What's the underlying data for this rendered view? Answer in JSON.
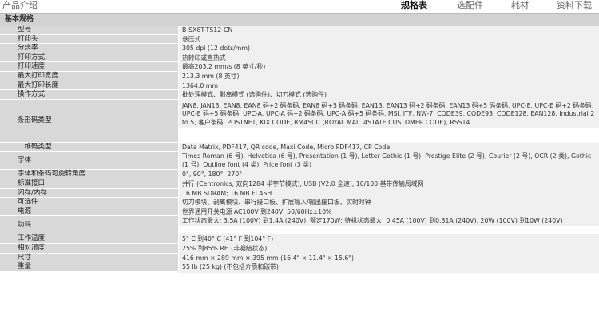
{
  "header": {
    "title": "产品介绍",
    "tabs": [
      {
        "label": "规格表",
        "active": true
      },
      {
        "label": "选配件",
        "active": false
      },
      {
        "label": "耗材",
        "active": false
      },
      {
        "label": "资料下载",
        "active": false
      }
    ]
  },
  "section": {
    "title": "基本规格"
  },
  "specs": [
    {
      "key": "型号",
      "value": "B-SX8T-TS12-CN"
    },
    {
      "key": "打印头",
      "value": "悬压式"
    },
    {
      "key": "分辨率",
      "value": "305 dpi (12 dots/mm)"
    },
    {
      "key": "打印方式",
      "value": "热转印或直热式"
    },
    {
      "key": "打印速度",
      "value": "最高203.2 mm/s (8 英寸/秒)"
    },
    {
      "key": "最大打印宽度",
      "value": "213.3 mm (8 英寸)"
    },
    {
      "key": "最大打印长度",
      "value": "1364.0 mm"
    },
    {
      "key": "操作方式",
      "value": "批处理模式、剥离模式 (选购件)、切刀模式 (选购件)"
    },
    {
      "key": "条形码类型",
      "value": "JAN8, JAN13, EAN8, EAN8 码+2 码条码, EAN8 码+5 码条码, EAN13, EAN13 码+2 码条码, EAN13 码+5 码条码, UPC-E, UPC-E 码+2 码条码, UPC-E 码+5 码条码, UPC-A, UPC-A 码+2 码条码, UPC-A 码+5 码条码, MSI, ITF, NW-7, CODE39, CODE93, CODE128, EAN128, Industrial 2 to 5, 客户条码, POSTNET, KIX CODE, RM4SCC (ROYAL MAIL 4STATE CUSTOMER CODE), RSS14"
    },
    {
      "key": "二维码类型",
      "value": "Data Matrix, PDF417, QR code, Maxi Code, Micro PDF417, CP Code"
    },
    {
      "key": "字体",
      "value": "Times Roman (6 号), Helvetica (6 号), Presentation (1 号), Letter Gothic (1 号), Prestige Elite (2 号), Courier (2 号), OCR (2 类), Gothic (1 号), Outline font (4 类), Price font (3 类)"
    },
    {
      "key": "字体和条码可旋转角度",
      "value": "0°, 90°, 180°, 270°"
    },
    {
      "key": "标准接口",
      "value": "并行 (Centronics, 双向1284 半字节模式), USB (V2.0 全速), 10/100 基带传输局域网"
    },
    {
      "key": "闪存/内存",
      "value": "16 MB SDRAM; 16 MB FLASH"
    },
    {
      "key": "可选件",
      "value": "切刀模块、剥离模块、串行接口板、扩展输入/输出接口板、实时时钟"
    },
    {
      "key": "电源",
      "value": "世界通用开关电源 AC100V 到240V, 50/60Hz±10%"
    },
    {
      "key": "功耗",
      "value": "工作状态最大: 3.5A (100V) 到1.4A (240V), 额定170W; 待机状态最大: 0.45A (100V) 到0.31A (240V), 20W (100V) 到10W (240V)"
    },
    {
      "key": "工作温度",
      "value": "5° C 到40° C (41° F 到104° F)"
    },
    {
      "key": "相对湿度",
      "value": "25% 到85% RH (非凝结状态)"
    },
    {
      "key": "尺寸",
      "value": "416 mm × 289 mm × 395 mm (16.4\" × 11.4\" × 15.6\")"
    },
    {
      "key": "重量",
      "value": "55 lb (25 kg) (不包括介质和碳带)"
    }
  ]
}
